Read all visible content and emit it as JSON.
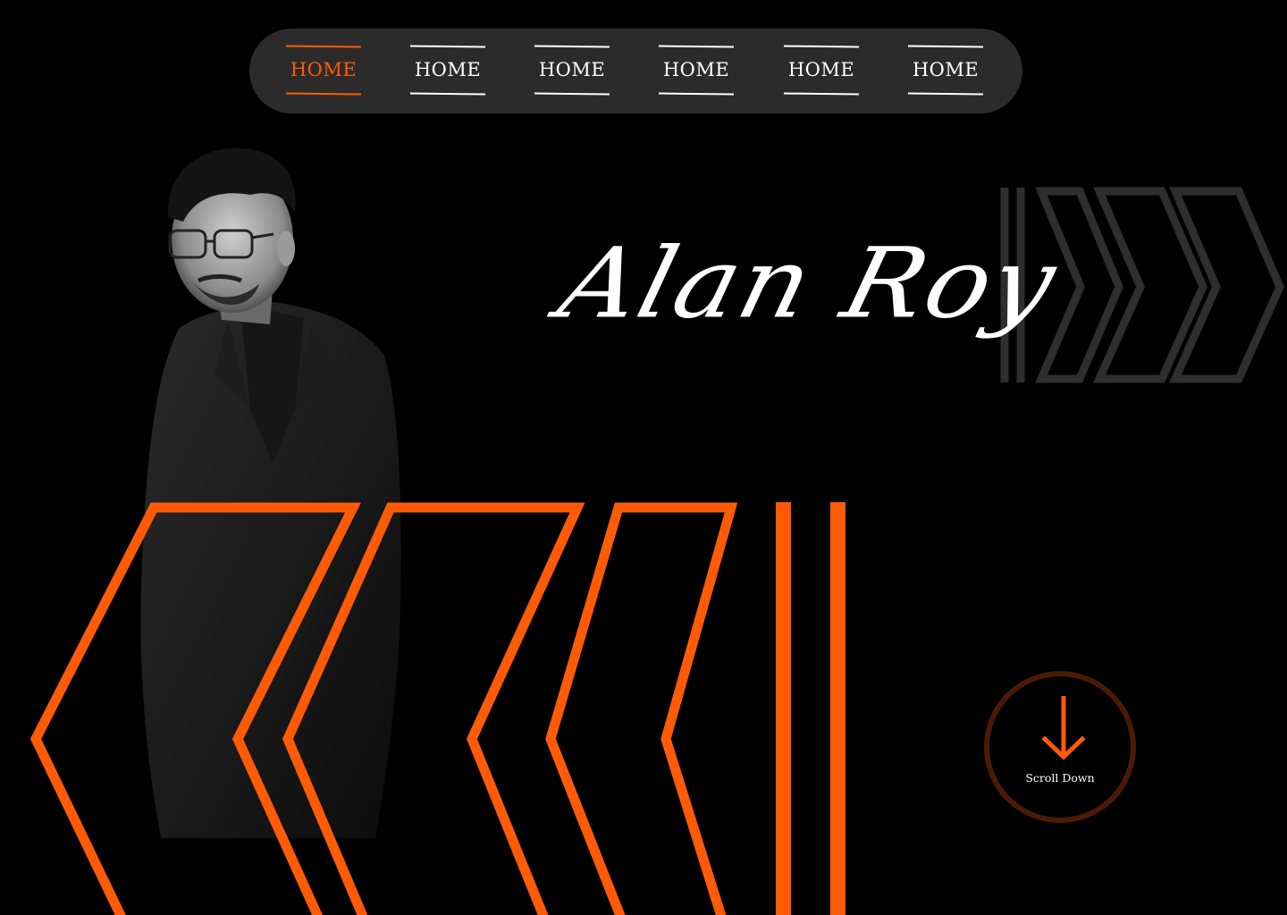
{
  "nav": {
    "items": [
      {
        "label": "HOME",
        "active": true
      },
      {
        "label": "HOME",
        "active": false
      },
      {
        "label": "HOME",
        "active": false
      },
      {
        "label": "HOME",
        "active": false
      },
      {
        "label": "HOME",
        "active": false
      },
      {
        "label": "HOME",
        "active": false
      }
    ]
  },
  "hero": {
    "name": "Alan Roy",
    "scroll_label": "Scroll Down",
    "portrait_icon": "person-portrait",
    "scroll_icon": "arrow-down-icon"
  },
  "colors": {
    "background": "#000000",
    "nav_background": "#2b2b2b",
    "accent": "#ff5b06",
    "scroll_ring": "#4a1a05",
    "grey_decor": "#2e2e2e",
    "text": "#ffffff"
  }
}
